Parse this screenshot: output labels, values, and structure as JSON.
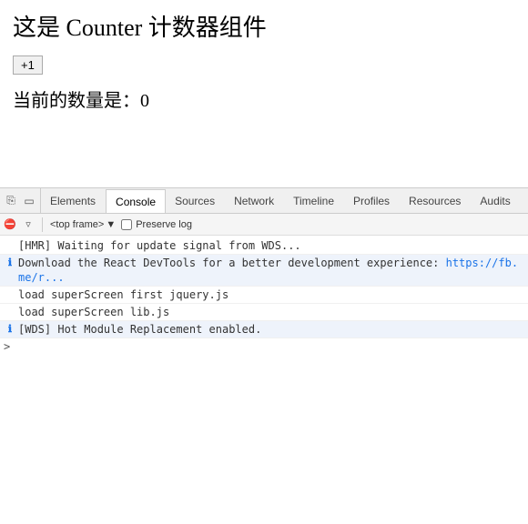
{
  "main": {
    "title": "这是 Counter 计数器组件",
    "button_label": "+1",
    "counter_text": "当前的数量是：",
    "counter_value": "0"
  },
  "devtools": {
    "tabs": [
      {
        "label": "Elements",
        "active": false
      },
      {
        "label": "Console",
        "active": true
      },
      {
        "label": "Sources",
        "active": false
      },
      {
        "label": "Network",
        "active": false
      },
      {
        "label": "Timeline",
        "active": false
      },
      {
        "label": "Profiles",
        "active": false
      },
      {
        "label": "Resources",
        "active": false
      },
      {
        "label": "Audits",
        "active": false
      }
    ],
    "frame_label": "<top frame>",
    "preserve_log_label": "Preserve log",
    "console_lines": [
      {
        "type": "normal",
        "icon": "",
        "text": "[HMR] Waiting for update signal from WDS..."
      },
      {
        "type": "info",
        "icon": "ℹ",
        "text": "Download the React DevTools for a better development experience: https://fb.me/r..."
      },
      {
        "type": "normal",
        "icon": "",
        "text": "load superScreen first jquery.js"
      },
      {
        "type": "normal",
        "icon": "",
        "text": "load superScreen lib.js"
      },
      {
        "type": "info",
        "icon": "ℹ",
        "text": "[WDS] Hot Module Replacement enabled."
      }
    ],
    "prompt_symbol": ">"
  }
}
